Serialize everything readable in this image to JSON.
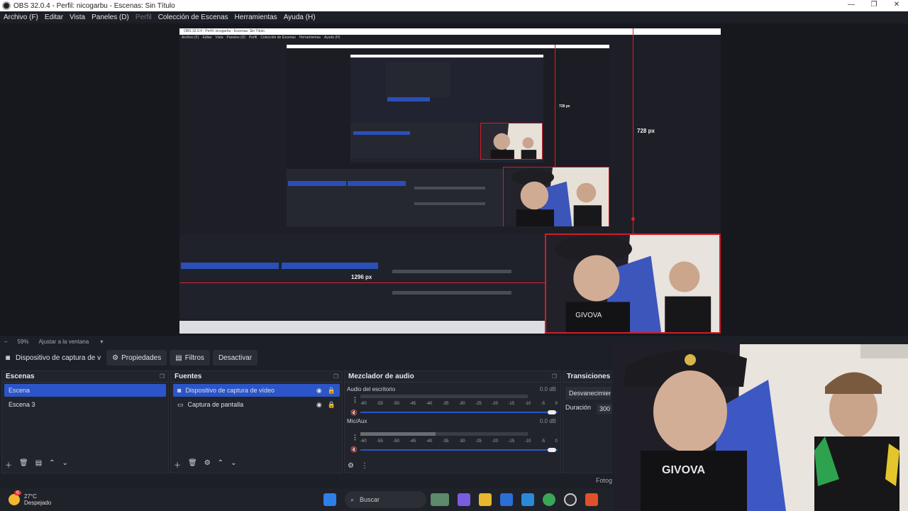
{
  "window": {
    "title": "OBS 32.0.4 - Perfil: nicogarbu - Escenas: Sin Título",
    "controls": [
      "—",
      "❐",
      "✕"
    ]
  },
  "menu": {
    "items": [
      {
        "label": "Archivo (F)",
        "enabled": true
      },
      {
        "label": "Editar",
        "enabled": true
      },
      {
        "label": "Vista",
        "enabled": true
      },
      {
        "label": "Paneles (D)",
        "enabled": true
      },
      {
        "label": "Perfil",
        "enabled": false
      },
      {
        "label": "Colección de Escenas",
        "enabled": true
      },
      {
        "label": "Herramientas",
        "enabled": true
      },
      {
        "label": "Ayuda (H)",
        "enabled": true
      }
    ]
  },
  "preview": {
    "measure_height": "728 px",
    "measure_width": "1296 px",
    "nested_measure_small": "728 px",
    "colors": {
      "selection": "#e01d2b",
      "accent": "#2b55c8"
    }
  },
  "zoombar": {
    "zoom": "59%",
    "fit": "Ajustar a la ventana"
  },
  "source_toolbar": {
    "source_name": "Dispositivo de captura de v",
    "properties": "Propiedades",
    "filters": "Filtros",
    "deactivate": "Desactivar"
  },
  "scenes": {
    "title": "Escenas",
    "items": [
      {
        "label": "Escena",
        "selected": true
      },
      {
        "label": "Escena 3",
        "selected": false
      }
    ]
  },
  "sources": {
    "title": "Fuentes",
    "items": [
      {
        "label": "Dispositivo de captura de vídeo",
        "selected": true
      },
      {
        "label": "Captura de pantalla",
        "selected": false
      }
    ]
  },
  "mixer": {
    "title": "Mezclador de audio",
    "channels": [
      {
        "name": "Audio del escritorio",
        "db": "0.0 dB",
        "level": 0.0
      },
      {
        "name": "Mic/Aux",
        "db": "0.0 dB",
        "level": 0.45
      }
    ],
    "ticks": [
      "-60",
      "-55",
      "-50",
      "-45",
      "-40",
      "-35",
      "-30",
      "-25",
      "-20",
      "-15",
      "-10",
      "-5",
      "0"
    ]
  },
  "transitions": {
    "title": "Transiciones de",
    "selected": "Desvanecimien",
    "duration_label": "Duración",
    "duration_value": "300"
  },
  "statusbar": {
    "fps_partial": "Fotog"
  },
  "taskbar": {
    "weather_temp": "27°C",
    "weather_desc": "Despejado",
    "badge": "6",
    "search_placeholder": "Buscar"
  }
}
